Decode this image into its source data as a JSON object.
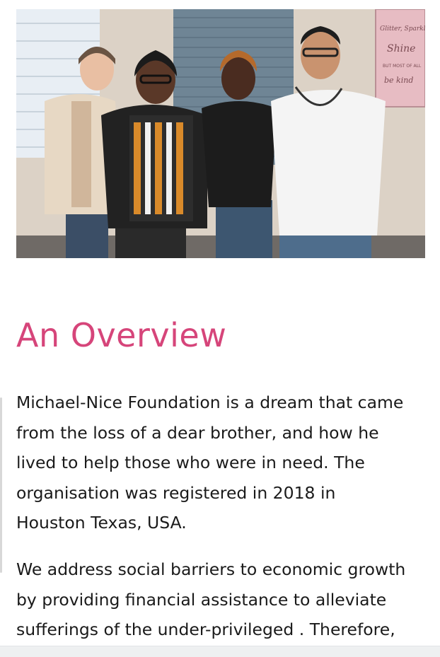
{
  "photo": {
    "alt_icon": "team-photo",
    "wall_sign_lines": [
      "Glitter, Sparkle",
      "Shine",
      "BUT MOST OF ALL",
      "be kind"
    ]
  },
  "overview": {
    "heading": "An Overview",
    "paragraph_1_lines": [
      "Michael-Nice Foundation is a dream that came",
      "from the loss of a dear brother, and how he",
      "lived to help those who were in need. The",
      "organisation was registered in 2018 in",
      "Houston Texas, USA."
    ],
    "paragraph_2_lines": [
      "We address social barriers to economic growth",
      "by providing financial assistance to alleviate",
      "sufferings of the under-privileged . Therefore,"
    ]
  },
  "colors": {
    "heading": "#d6457a",
    "body_text": "#1a1a1a",
    "background": "#ffffff"
  }
}
